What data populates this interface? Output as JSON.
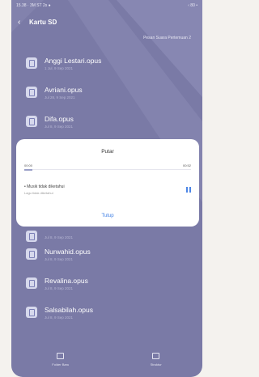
{
  "status_bar": {
    "left": "15.38 · 3M ST 2s ●",
    "right": "‹ 80 •"
  },
  "header": {
    "title": "Kartu SD"
  },
  "folder": {
    "name": "Pesan Suara Pertemuan 2"
  },
  "files": [
    {
      "name": "Anggi Lestari.opus",
      "meta": "1 Jul, 9 Sep 2021"
    },
    {
      "name": "Avriani.opus",
      "meta": "Jul 28, 9 Sep 2021"
    },
    {
      "name": "Difa.opus",
      "meta": "Jul 8, 9 Sep 2021"
    },
    {
      "name": "",
      "meta": "Jul 8, 9 Sep 2021"
    },
    {
      "name": "Nurwahid.opus",
      "meta": "Jul 8, 9 Sep 2021"
    },
    {
      "name": "Revalina.opus",
      "meta": "Jul 8, 9 Sep 2021"
    },
    {
      "name": "Salsabilah.opus",
      "meta": "Jul 8, 9 Sep 2021"
    }
  ],
  "dialog": {
    "title": "Putar",
    "time_current": "00:00",
    "time_total": "00:52",
    "now_playing": "• Musik tidak diketahui",
    "sub_text": "Lagu tidak diketahui",
    "close_label": "Tutup",
    "progress_fraction": 0.05
  },
  "bottom_bar": {
    "left_label": "Folder Baru",
    "right_label": "Struktur"
  }
}
